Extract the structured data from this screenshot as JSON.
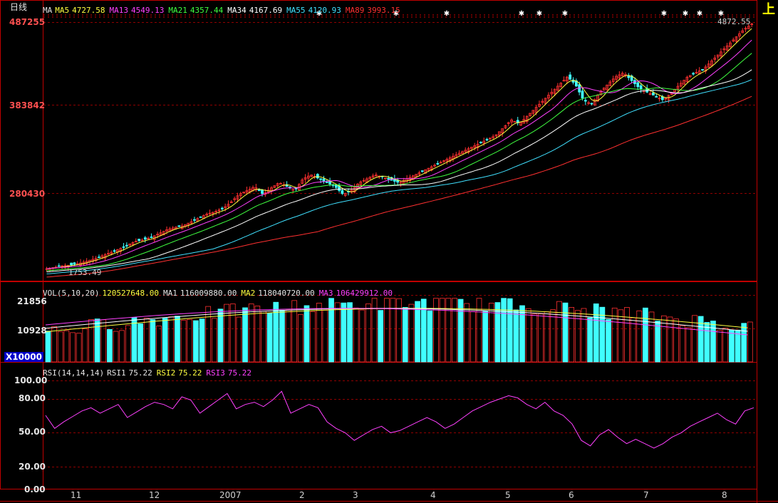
{
  "period_label": "日线",
  "price_legend": [
    {
      "name": "MA",
      "value": "",
      "color": "#e6e6e6"
    },
    {
      "name": "MA5",
      "value": "4727.58",
      "color": "#ffff40"
    },
    {
      "name": "MA13",
      "value": "4549.13",
      "color": "#ff40ff"
    },
    {
      "name": "MA21",
      "value": "4357.44",
      "color": "#40ff40"
    },
    {
      "name": "MA34",
      "value": "4167.69",
      "color": "#ffffff"
    },
    {
      "name": "MA55",
      "value": "4120.93",
      "color": "#40e0ff"
    },
    {
      "name": "MA89",
      "value": "3993.15",
      "color": "#ff3030"
    }
  ],
  "price_axis": [
    "487255",
    "383842",
    "280430"
  ],
  "price_high_label": "4872.55",
  "price_low_label": "1753.49",
  "volume_legend": [
    {
      "name": "VOL(5,10,20)",
      "value": "120527648.00",
      "color": "#e6e6e6",
      "vcolor": "#ffff40"
    },
    {
      "name": "MA1",
      "value": "116009880.00",
      "color": "#e6e6e6",
      "vcolor": "#e6e6e6"
    },
    {
      "name": "MA2",
      "value": "118040720.00",
      "color": "#ffff40",
      "vcolor": "#e6e6e6"
    },
    {
      "name": "MA3",
      "value": "106429912.00",
      "color": "#ff40ff",
      "vcolor": "#ff40ff"
    }
  ],
  "volume_axis": [
    "21856",
    "10928"
  ],
  "volume_unit": "X10000",
  "rsi_legend": [
    {
      "name": "RSI(14,14,14)",
      "value": "",
      "color": "#e6e6e6"
    },
    {
      "name": "RSI1",
      "value": "75.22",
      "color": "#e6e6e6"
    },
    {
      "name": "RSI2",
      "value": "75.22",
      "color": "#ffff40"
    },
    {
      "name": "RSI3",
      "value": "75.22",
      "color": "#ff40ff"
    }
  ],
  "rsi_axis": [
    "100.00",
    "80.00",
    "50.00",
    "20.00",
    "0.00"
  ],
  "months": [
    "11",
    "12",
    "2007",
    "2",
    "3",
    "4",
    "5",
    "6",
    "7",
    "8"
  ],
  "corner_button": "上",
  "colors": {
    "up": "#ff3030",
    "down": "#40ffff",
    "grid": "#a00000",
    "rsi": "#ff40ff",
    "panel_border": "#c00000"
  },
  "chart_data": {
    "type": "line",
    "price_close": [
      1753,
      1770,
      1790,
      1800,
      1820,
      1850,
      1880,
      1920,
      1960,
      2000,
      2050,
      2100,
      2120,
      2150,
      2200,
      2250,
      2280,
      2300,
      2350,
      2400,
      2450,
      2480,
      2520,
      2600,
      2700,
      2750,
      2800,
      2700,
      2780,
      2850,
      2800,
      2750,
      2900,
      2950,
      2900,
      2850,
      2800,
      2700,
      2750,
      2850,
      2900,
      2950,
      2920,
      2880,
      2850,
      2900,
      2950,
      3000,
      3050,
      3100,
      3150,
      3200,
      3250,
      3300,
      3350,
      3400,
      3450,
      3550,
      3650,
      3600,
      3700,
      3800,
      3900,
      4000,
      4100,
      4200,
      4100,
      3900,
      3850,
      4000,
      4100,
      4200,
      4250,
      4150,
      4050,
      4000,
      3950,
      3900,
      4000,
      4100,
      4200,
      4250,
      4300,
      4400,
      4500,
      4600,
      4700,
      4800,
      4872
    ],
    "rsi": [
      68,
      56,
      62,
      67,
      72,
      75,
      70,
      74,
      78,
      66,
      71,
      76,
      80,
      78,
      74,
      85,
      82,
      70,
      76,
      82,
      88,
      74,
      78,
      80,
      76,
      82,
      90,
      70,
      74,
      78,
      75,
      62,
      56,
      52,
      45,
      50,
      55,
      58,
      52,
      54,
      58,
      62,
      66,
      62,
      56,
      60,
      66,
      72,
      76,
      80,
      83,
      86,
      84,
      78,
      74,
      80,
      72,
      68,
      60,
      45,
      40,
      50,
      55,
      48,
      42,
      46,
      42,
      38,
      42,
      48,
      52,
      58,
      62,
      66,
      70,
      64,
      60,
      72,
      75
    ]
  }
}
